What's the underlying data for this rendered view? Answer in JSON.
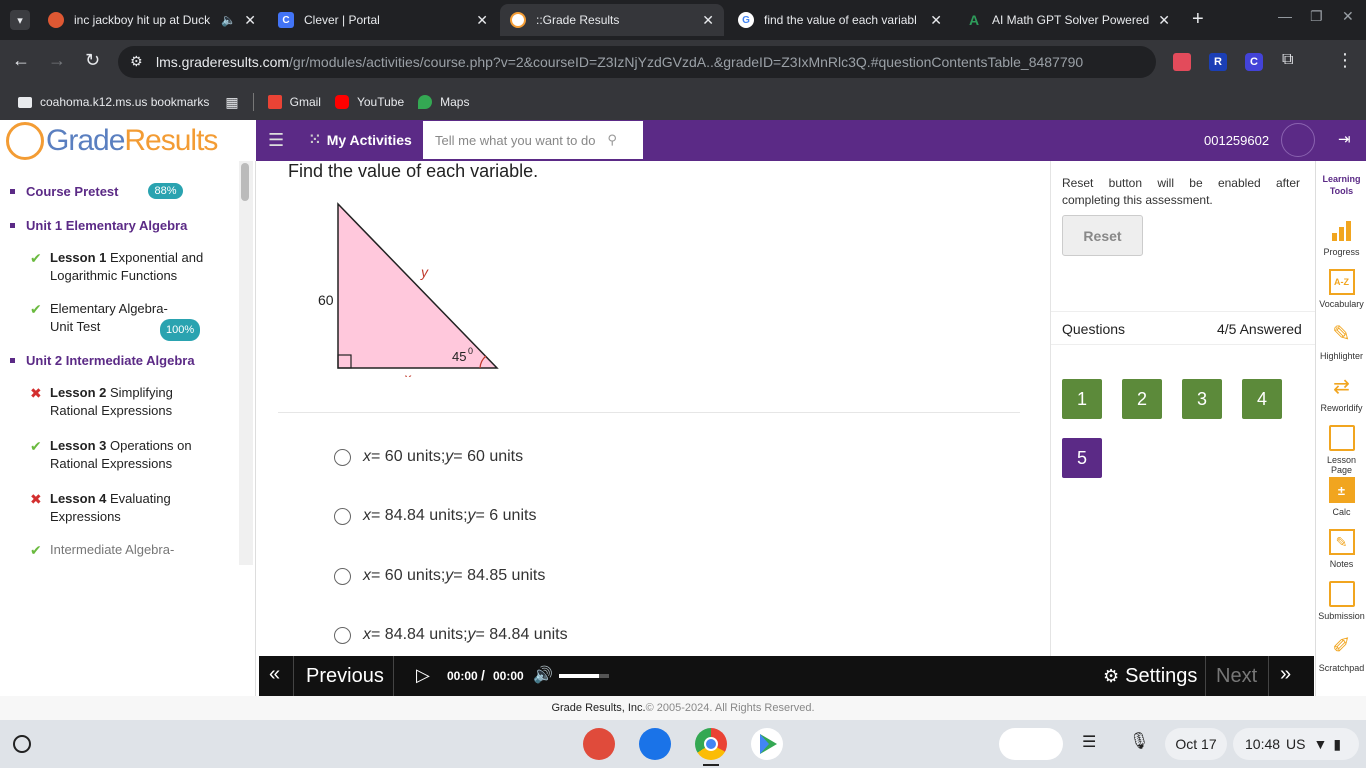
{
  "browser": {
    "tabs": [
      {
        "title": "inc jackboy hit up at Duck",
        "icon": "duckduckgo-icon",
        "color": "#de5833",
        "audio": true
      },
      {
        "title": "Clever | Portal",
        "icon": "clever-icon",
        "color": "#4274f6",
        "badge": "C"
      },
      {
        "title": "::Grade Results",
        "icon": "graderesults-icon",
        "color": "#f39c34",
        "active": true
      },
      {
        "title": "find the value of each variabl",
        "icon": "google-icon",
        "color": "#4285f4",
        "badge": "G"
      },
      {
        "title": "AI Math GPT Solver Powered",
        "icon": "mathgpt-icon",
        "color": "#2e9d5b",
        "badge": "A"
      }
    ],
    "url_host": "lms.graderesults.com",
    "url_path": "/gr/modules/activities/course.php?v=2&courseID=Z3IzNjYzdGVzdA..&gradeID=Z3IxMnRlc3Q.#questionContentsTable_8487790",
    "bookmarks_folder": "coahoma.k12.ms.us bookmarks",
    "bookmarks": [
      {
        "label": "Gmail",
        "color": "#ea4335"
      },
      {
        "label": "YouTube",
        "color": "#ff0000"
      },
      {
        "label": "Maps",
        "color": "#34a853"
      }
    ]
  },
  "app": {
    "logo_part1": "Grade",
    "logo_part2": "Results",
    "menu_label": "My Activities",
    "search_placeholder": "Tell me what you want to do",
    "student_id": "001259602"
  },
  "sidebar": {
    "course_pretest": "Course Pretest",
    "course_pretest_pct": "88%",
    "unit1": "Unit 1 Elementary Algebra",
    "lesson1_bold": "Lesson 1",
    "lesson1_text": " Exponential and Logarithmic Functions",
    "unit1_test": "Elementary Algebra- Unit Test",
    "unit1_test_pct": "100%",
    "unit2": "Unit 2 Intermediate Algebra",
    "lesson2_bold": "Lesson 2",
    "lesson2_text": " Simplifying Rational Expressions",
    "lesson3_bold": "Lesson 3",
    "lesson3_text": " Operations on Rational Expressions",
    "lesson4_bold": "Lesson 4",
    "lesson4_text": " Evaluating Expressions",
    "unit2_test": "Intermediate Algebra-"
  },
  "question": {
    "prompt": "Find the value of each variable.",
    "figure": {
      "side_label": "60",
      "hyp_label": "y",
      "base_label": "x",
      "angle_label": "45",
      "angle_sup": "0"
    },
    "options": [
      {
        "x": "x",
        "y": "y",
        "xval": " = 60 units; ",
        "yval": " = 60 units"
      },
      {
        "x": "x",
        "y": "y",
        "xval": " = 84.84 units; ",
        "yval": " = 6 units"
      },
      {
        "x": "x",
        "y": "y",
        "xval": " = 60 units; ",
        "yval": " = 84.85 units"
      },
      {
        "x": "x",
        "y": "y",
        "xval": " = 84.84 units; ",
        "yval": " = 84.84 units"
      }
    ]
  },
  "right_panel": {
    "reset_note": "Reset button will be enabled after completing this assessment.",
    "reset_label": "Reset",
    "questions_label": "Questions",
    "answered": "4/5 Answered",
    "numbers": [
      "1",
      "2",
      "3",
      "4",
      "5"
    ]
  },
  "tools": {
    "header": "Learning Tools",
    "items": [
      "Progress",
      "Vocabulary",
      "Highlighter",
      "Reworldify",
      "Lesson Page",
      "Calc",
      "Notes",
      "Submission",
      "Scratchpad"
    ]
  },
  "player": {
    "previous": "Previous",
    "time_current": "00:00",
    "time_sep": "/",
    "time_total": "00:00",
    "settings": "Settings",
    "next": "Next"
  },
  "footer": {
    "company": "Grade Results, Inc.",
    "copyright": " © 2005-2024. All Rights Reserved."
  },
  "shelf": {
    "date": "Oct 17",
    "time": "10:48",
    "locale": "US"
  }
}
